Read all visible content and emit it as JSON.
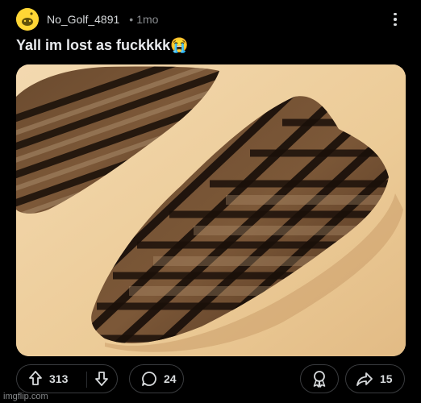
{
  "post": {
    "username": "No_Golf_4891",
    "separator": "•",
    "time": "1mo",
    "title": "Yall im lost as fuckkkk😭"
  },
  "icons": {
    "avatar": "snoo-avatar-icon",
    "more": "more-vertical-icon",
    "upvote": "arrow-up-icon",
    "downvote": "arrow-down-icon",
    "comment": "comment-bubble-icon",
    "award": "award-icon",
    "share": "share-arrow-icon"
  },
  "media": {
    "image_description": "grilled-steak-image"
  },
  "actions": {
    "upvotes": "313",
    "comments": "24",
    "shares": "15"
  },
  "watermark": "imgflip.com",
  "colors": {
    "background": "#000000",
    "avatar": "#ffd635",
    "text": "#d7dadc",
    "muted": "#8a8d90",
    "pill_border": "#3a3c3f"
  }
}
